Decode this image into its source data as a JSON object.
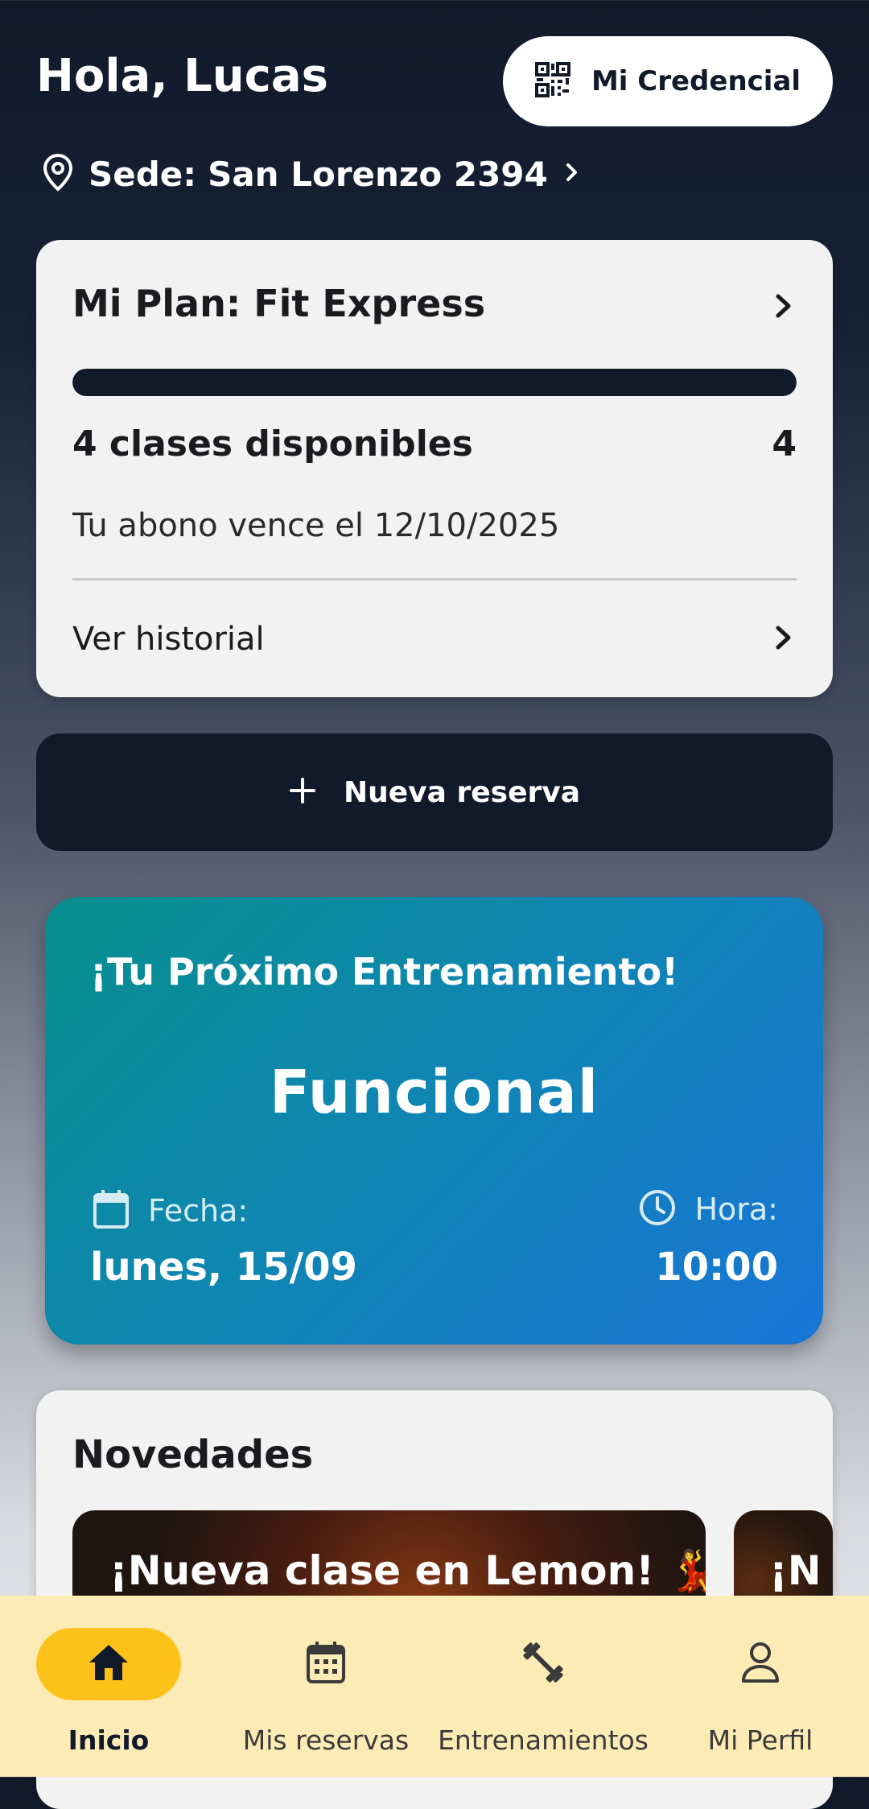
{
  "header": {
    "greeting": "Hola, Lucas",
    "credential_button": {
      "label": "Mi Credencial",
      "icon": "qr-code-icon"
    },
    "location": {
      "prefix": "Sede:",
      "name": "San Lorenzo 2394",
      "icon": "location-pin-icon"
    }
  },
  "plan_card": {
    "title": "Mi Plan: Fit Express",
    "progress_fraction": 1.0,
    "classes_label": "4 clases disponibles",
    "classes_count": "4",
    "expiry_text": "Tu abono vence el 12/10/2025",
    "history_label": "Ver historial"
  },
  "new_reservation": {
    "label": "Nueva reserva",
    "icon": "plus-icon"
  },
  "next_training": {
    "title": "¡Tu Próximo Entrenamiento!",
    "class_name": "Funcional",
    "date_label": "Fecha:",
    "date_value": "lunes, 15/09",
    "time_label": "Hora:",
    "time_value": "10:00"
  },
  "news": {
    "title": "Novedades",
    "items": [
      {
        "title": "¡Nueva clase en Lemon! 💃"
      },
      {
        "title": "¡N"
      }
    ]
  },
  "bottom_nav": [
    {
      "label": "Inicio",
      "icon": "home-icon",
      "active": true
    },
    {
      "label": "Mis reservas",
      "icon": "calendar-icon",
      "active": false
    },
    {
      "label": "Entrenamientos",
      "icon": "dumbbell-icon",
      "active": false
    },
    {
      "label": "Mi Perfil",
      "icon": "person-icon",
      "active": false
    }
  ],
  "colors": {
    "navy": "#111a2b",
    "card_bg": "#f2f2f2",
    "accent_yellow": "#fdc21a",
    "nav_bg": "#fdebb6",
    "teal_gradient_start": "#078f8c",
    "blue_gradient_end": "#1875d6"
  }
}
